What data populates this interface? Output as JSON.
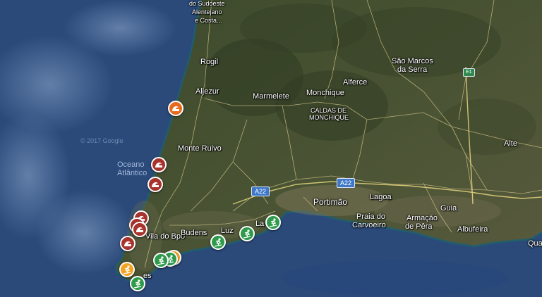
{
  "map": {
    "credit_text": "© 2017 Google",
    "water_label_1": "Oceano",
    "water_label_2": "Atlântico",
    "coast_park_line1": "do Sudoeste",
    "coast_park_line2": "Alentejano",
    "coast_park_line3": "e Costa..."
  },
  "places": {
    "rogil": "Rogil",
    "aljezur": "Aljezur",
    "marmelete": "Marmelete",
    "monchique": "Monchique",
    "alferce": "Alferce",
    "sao_marcos_1": "São Marcos",
    "sao_marcos_2": "da Serra",
    "caldas_1": "CALDAS DE",
    "caldas_2": "MONCHIQUE",
    "monte_ruivo": "Monte Ruivo",
    "alte": "Alte",
    "portimao": "Portimão",
    "lagoa": "Lagoa",
    "guia": "Guia",
    "praia_carvoeiro_1": "Praia do",
    "praia_carvoeiro_2": "Carvoeiro",
    "armacao_1": "Armação",
    "armacao_2": "de Pêra",
    "albufeira": "Albufeira",
    "vila_do_bispo": "Vila do Bpo",
    "budens": "Budens",
    "luz": "Luz",
    "lagos": "La",
    "sagres": "es",
    "quarteira": "Qua"
  },
  "roads": {
    "a22_west": "A22",
    "a22_east": "A22",
    "e1": "E1"
  },
  "colors": {
    "marker_red": "#a8322c",
    "marker_orange": "#e56a1e",
    "marker_yellow": "#f2a324",
    "marker_green": "#2e9a4a",
    "ocean": "#2b4a7a"
  },
  "markers": [
    {
      "type": "surf-spot",
      "icon": "wave-icon",
      "color": "orange"
    },
    {
      "type": "surf-spot",
      "icon": "wave-icon",
      "color": "red"
    },
    {
      "type": "surf-spot",
      "icon": "wave-icon",
      "color": "red"
    },
    {
      "type": "surf-spot",
      "icon": "wave-icon",
      "color": "red"
    },
    {
      "type": "surf-spot",
      "icon": "wave-icon",
      "color": "red"
    },
    {
      "type": "surf-spot",
      "icon": "wave-icon",
      "color": "red"
    },
    {
      "type": "surf-spot",
      "icon": "wave-icon",
      "color": "red"
    },
    {
      "type": "surf-school",
      "icon": "surfer-icon",
      "color": "green"
    },
    {
      "type": "surf-school",
      "icon": "surfer-icon",
      "color": "green"
    },
    {
      "type": "surf-school",
      "icon": "surfer-icon",
      "color": "green"
    },
    {
      "type": "surf-school",
      "icon": "surfer-icon",
      "color": "yellow"
    },
    {
      "type": "surf-school",
      "icon": "surfer-icon",
      "color": "green"
    },
    {
      "type": "surf-school",
      "icon": "surfer-icon",
      "color": "green"
    },
    {
      "type": "surf-school",
      "icon": "surfer-icon",
      "color": "yellow"
    },
    {
      "type": "surf-school",
      "icon": "surfer-icon",
      "color": "green"
    }
  ]
}
